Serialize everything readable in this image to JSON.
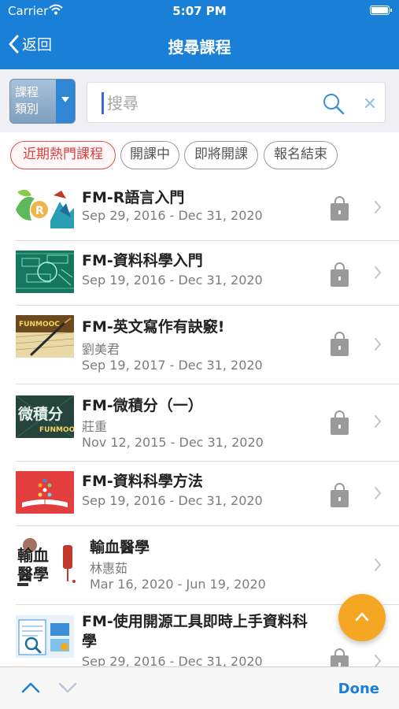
{
  "status_bar": {
    "carrier": "Carrier",
    "time": "5:07 PM"
  },
  "nav": {
    "back_label": "返回",
    "title": "搜尋課程"
  },
  "filter": {
    "category_label": "課程類別",
    "search_placeholder": "搜尋",
    "search_value": ""
  },
  "chips": [
    {
      "label": "近期熱門課程",
      "active": true
    },
    {
      "label": "開課中",
      "active": false
    },
    {
      "label": "即將開課",
      "active": false
    },
    {
      "label": "報名結束",
      "active": false
    }
  ],
  "courses": [
    {
      "title": "FM-R語言入門",
      "instructor": "",
      "dates": "Sep 29, 2016 - Dec 31, 2020",
      "locked": true
    },
    {
      "title": "FM-資料科學入門",
      "instructor": "",
      "dates": "Sep 19, 2016 - Dec 31, 2020",
      "locked": true
    },
    {
      "title": "FM-英文寫作有訣竅!",
      "instructor": "劉美君",
      "dates": "Sep 19, 2017 - Dec 31, 2020",
      "locked": true
    },
    {
      "title": "FM-微積分（一）",
      "instructor": "莊重",
      "dates": "Nov 12, 2015 - Dec 31, 2020",
      "locked": true
    },
    {
      "title": "FM-資料科學方法",
      "instructor": "",
      "dates": "Sep 19, 2016 - Dec 31, 2020",
      "locked": true
    },
    {
      "title": "輸血醫學",
      "instructor": "林惠茹",
      "dates": "Mar 16, 2020 - Jun 19, 2020",
      "locked": false
    },
    {
      "title": "FM-使用開源工具即時上手資料科學",
      "instructor": "",
      "dates": "Sep 29, 2016 - Dec 31, 2020",
      "locked": true
    }
  ],
  "thumb_text": {
    "funmooc": "FUNMOOC",
    "calculus": "微積分",
    "blood_1": "輸血",
    "blood_2": "醫學"
  },
  "toolbar": {
    "done_label": "Done"
  },
  "colors": {
    "primary": "#1a7fd6",
    "accent": "#f5a623",
    "chip_active": "#d8403f"
  }
}
